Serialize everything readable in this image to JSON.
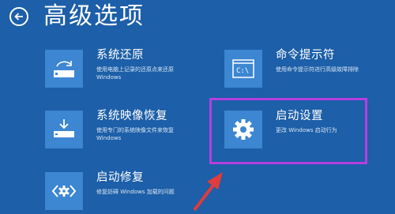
{
  "page": {
    "title": "高级选项"
  },
  "icons": {
    "back": "back-arrow-icon",
    "system_restore": "restore-drive-icon",
    "command_prompt": "command-prompt-icon",
    "system_image_recovery": "image-recovery-icon",
    "startup_settings": "gear-icon",
    "startup_repair": "repair-icon"
  },
  "colors": {
    "background": "#1d5fa8",
    "tile": "#3c86d2",
    "highlight": "#b53fe0",
    "arrow": "#e03c3c"
  },
  "options": {
    "system_restore": {
      "title": "系统还原",
      "desc": "使用电脑上记录的还原点来还原 Windows"
    },
    "command_prompt": {
      "title": "命令提示符",
      "desc": "使用命令提示符进行高级故障排除"
    },
    "system_image_recovery": {
      "title": "系统映像恢复",
      "desc": "使用专门的系统映像文件来恢复 Windows"
    },
    "startup_settings": {
      "title": "启动设置",
      "desc": "更改 Windows 启动行为"
    },
    "startup_repair": {
      "title": "启动修复",
      "desc": "修复妨碍 Windows 加载的问题"
    }
  }
}
